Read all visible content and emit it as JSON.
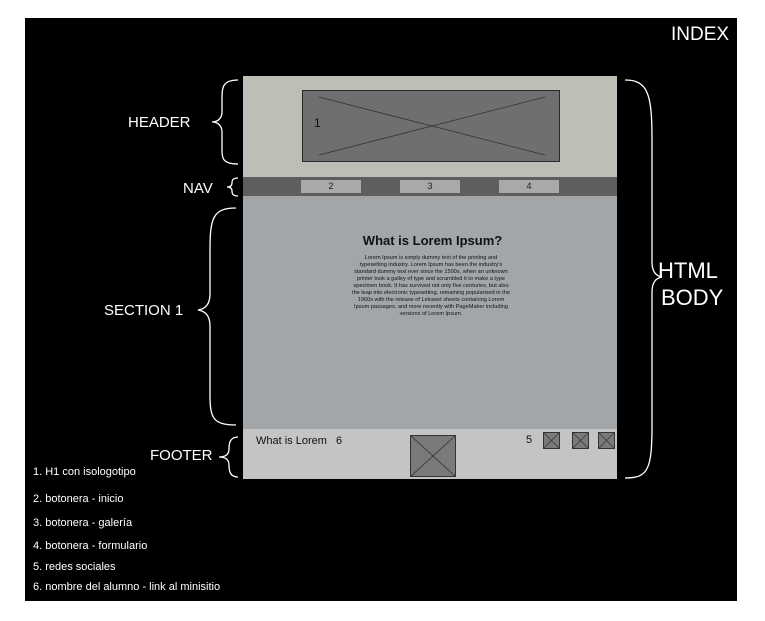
{
  "title": "INDEX",
  "labels": {
    "header": "HEADER",
    "nav": "NAV",
    "section": "SECTION 1",
    "footer": "FOOTER",
    "body_line1": "HTML",
    "body_line2": "BODY"
  },
  "header": {
    "logo_number": "1"
  },
  "nav": {
    "buttons": [
      "2",
      "3",
      "4"
    ]
  },
  "section": {
    "title": "What is Lorem Ipsum?",
    "body": "Lorem Ipsum is simply dummy text of the printing and typesetting industry. Lorem Ipsum has been the industry's standard dummy text ever since the 1500s, when an unknown printer took a galley of type and scrambled it to make a type specimen book. It has survived not only five centuries, but also the leap into electronic typesetting, remaining popularised in the 1960s with the release of Letraset sheets containing Lorem Ipsum passages, and more recently with PageMaker including versions of Lorem Ipsum."
  },
  "footer": {
    "name_text": "What is Lorem",
    "name_number": "6",
    "social_number": "5"
  },
  "legend": [
    "1. H1 con isologotipo",
    "2. botonera - inicio",
    "3. botonera - galería",
    "4. botonera - formulario",
    "5. redes sociales",
    "6. nombre del alumno - link al minisitio"
  ]
}
